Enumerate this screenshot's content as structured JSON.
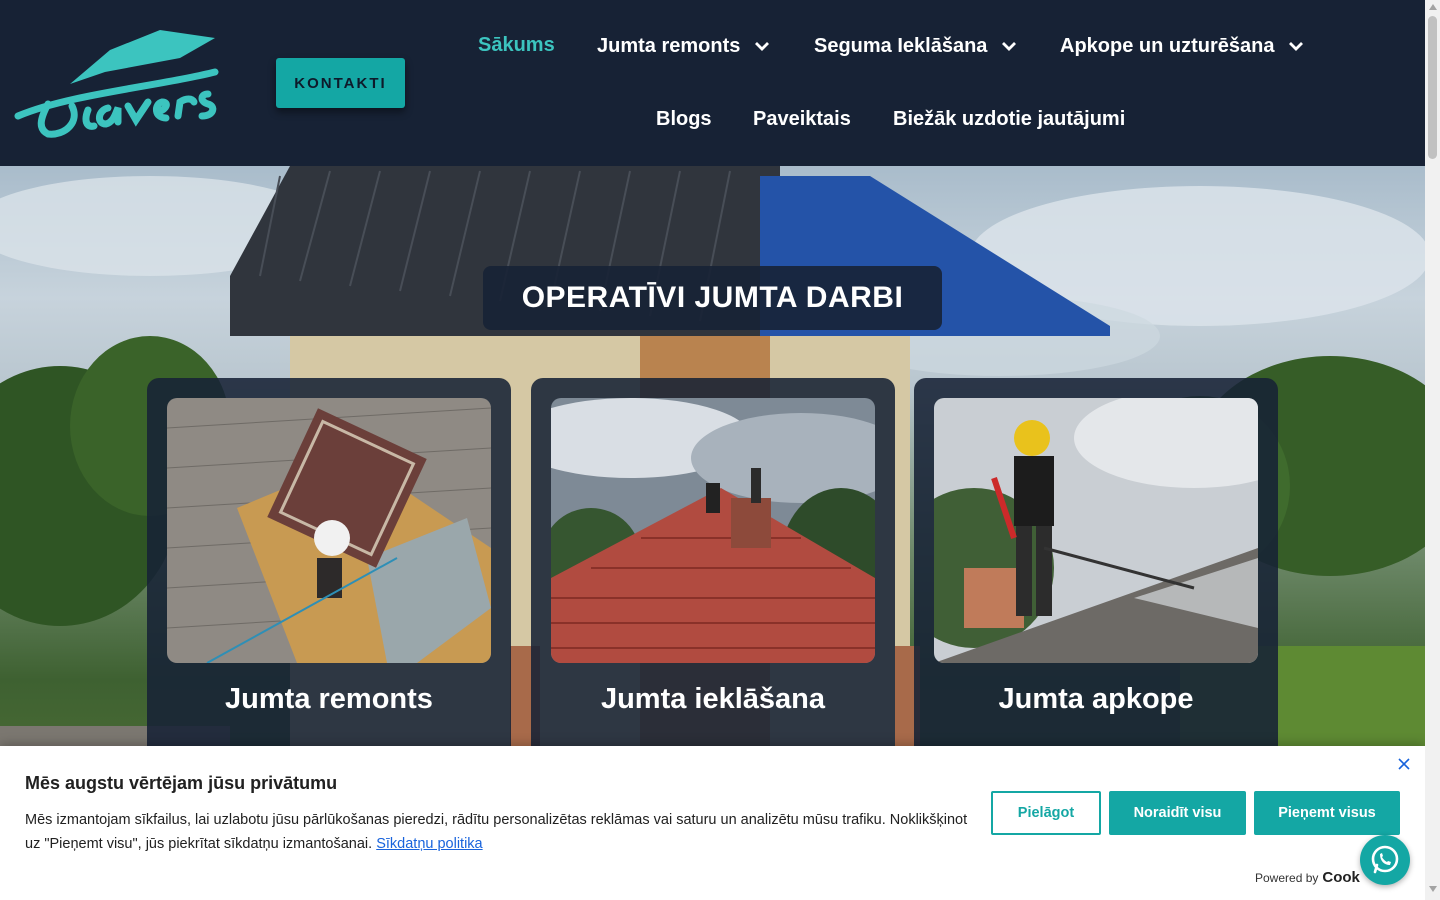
{
  "header": {
    "logo_text": "Diavers",
    "contact_button": "KONTAKTI",
    "nav": [
      {
        "label": "Sākums",
        "active": true,
        "dropdown": false
      },
      {
        "label": "Jumta remonts",
        "active": false,
        "dropdown": true
      },
      {
        "label": "Seguma Ieklāšana",
        "active": false,
        "dropdown": true
      },
      {
        "label": "Apkope un uzturēšana",
        "active": false,
        "dropdown": true
      },
      {
        "label": "Blogs",
        "active": false,
        "dropdown": false
      },
      {
        "label": "Paveiktais",
        "active": false,
        "dropdown": false
      },
      {
        "label": "Biežāk uzdotie jautājumi",
        "active": false,
        "dropdown": false
      }
    ]
  },
  "hero": {
    "title": "OPERATĪVI JUMTA DARBI",
    "cards": [
      {
        "title": "Jumta remonts",
        "image": "roof-repair-photo"
      },
      {
        "title": "Jumta ieklāšana",
        "image": "roof-tiles-photo"
      },
      {
        "title": "Jumta apkope",
        "image": "roof-cleaning-photo"
      }
    ]
  },
  "cookie_banner": {
    "title": "Mēs augstu vērtējam jūsu privātumu",
    "text": "Mēs izmantojam sīkfailus, lai uzlabotu jūsu pārlūkošanas pieredzi, rādītu personalizētas reklāmas vai saturu un analizētu mūsu trafiku. Noklikšķinot uz \"Pieņemt visu\", jūs piekrītat sīkdatņu izmantošanai.",
    "policy_link": "Sīkdatņu politika",
    "customize_button": "Pielāgot",
    "reject_button": "Noraidīt visu",
    "accept_button": "Pieņemt visus",
    "powered_by": "Powered by",
    "powered_brand": "Cook"
  },
  "colors": {
    "header_bg": "#172235",
    "accent": "#14a7a4",
    "active_nav": "#3cc4bf"
  },
  "icons": [
    "chevron-down-icon",
    "close-icon",
    "whatsapp-icon"
  ]
}
